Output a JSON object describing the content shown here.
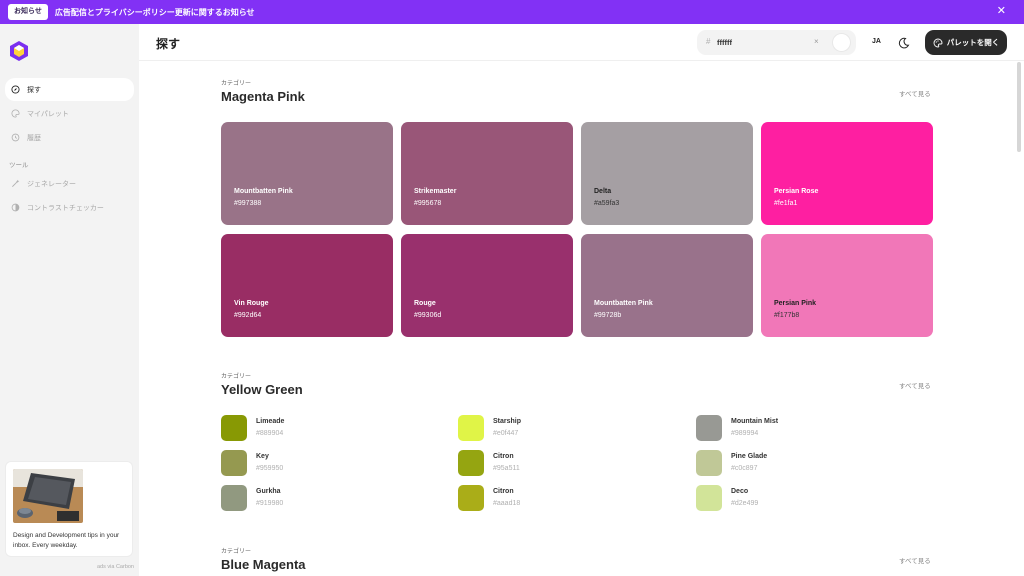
{
  "banner": {
    "tag": "お知らせ",
    "text": "広告配信とプライバシーポリシー更新に関するお知らせ",
    "close_icon": "close-icon"
  },
  "sidebar": {
    "logo_icon": "hexagon-logo-icon",
    "items": [
      {
        "label": "探す",
        "icon": "compass-icon",
        "active": true
      },
      {
        "label": "マイパレット",
        "icon": "palette-icon",
        "active": false
      },
      {
        "label": "履歴",
        "icon": "history-icon",
        "active": false
      }
    ],
    "tools_heading": "ツール",
    "tools": [
      {
        "label": "ジェネレーター",
        "icon": "magic-wand-icon"
      },
      {
        "label": "コントラストチェッカー",
        "icon": "contrast-icon"
      }
    ],
    "ad": {
      "text": "Design and Development tips in your inbox. Every weekday.",
      "via": "ads via Carbon"
    }
  },
  "header": {
    "title": "探す",
    "search_hash": "#",
    "search_value": "ffffff",
    "search_clear": "×",
    "search_color": "#ffffff",
    "lang": "JA",
    "theme_icon": "moon-icon",
    "open_button": "パレットを開く",
    "open_icon": "palette-icon"
  },
  "sections": [
    {
      "label": "カテゴリー",
      "title": "Magenta Pink",
      "see_all": "すべて見る",
      "cards": [
        {
          "name": "Mountbatten Pink",
          "hex": "#997388",
          "color": "#997388",
          "text": "light"
        },
        {
          "name": "Strikemaster",
          "hex": "#995678",
          "color": "#995678",
          "text": "light"
        },
        {
          "name": "Delta",
          "hex": "#a59fa3",
          "color": "#a59fa3",
          "text": "dark"
        },
        {
          "name": "Persian Rose",
          "hex": "#fe1fa1",
          "color": "#fe1fa1",
          "text": "light"
        },
        {
          "name": "Vin Rouge",
          "hex": "#992d64",
          "color": "#992d64",
          "text": "light"
        },
        {
          "name": "Rouge",
          "hex": "#99306d",
          "color": "#99306d",
          "text": "light"
        },
        {
          "name": "Mountbatten Pink",
          "hex": "#99728b",
          "color": "#99728b",
          "text": "light"
        },
        {
          "name": "Persian Pink",
          "hex": "#f177b8",
          "color": "#f177b8",
          "text": "dark"
        }
      ]
    },
    {
      "label": "カテゴリー",
      "title": "Yellow Green",
      "see_all": "すべて見る",
      "items": [
        {
          "name": "Limeade",
          "hex": "#889904",
          "color": "#889904"
        },
        {
          "name": "Key",
          "hex": "#959950",
          "color": "#959950"
        },
        {
          "name": "Gurkha",
          "hex": "#919980",
          "color": "#919980"
        },
        {
          "name": "Starship",
          "hex": "#e0f447",
          "color": "#e0f447"
        },
        {
          "name": "Citron",
          "hex": "#95a511",
          "color": "#95a511"
        },
        {
          "name": "Citron",
          "hex": "#aaad18",
          "color": "#aaad18"
        },
        {
          "name": "Mountain Mist",
          "hex": "#989994",
          "color": "#989994"
        },
        {
          "name": "Pine Glade",
          "hex": "#c0c897",
          "color": "#c0c897"
        },
        {
          "name": "Deco",
          "hex": "#d2e499",
          "color": "#d2e499"
        }
      ]
    },
    {
      "label": "カテゴリー",
      "title": "Blue Magenta",
      "see_all": "すべて見る"
    }
  ]
}
